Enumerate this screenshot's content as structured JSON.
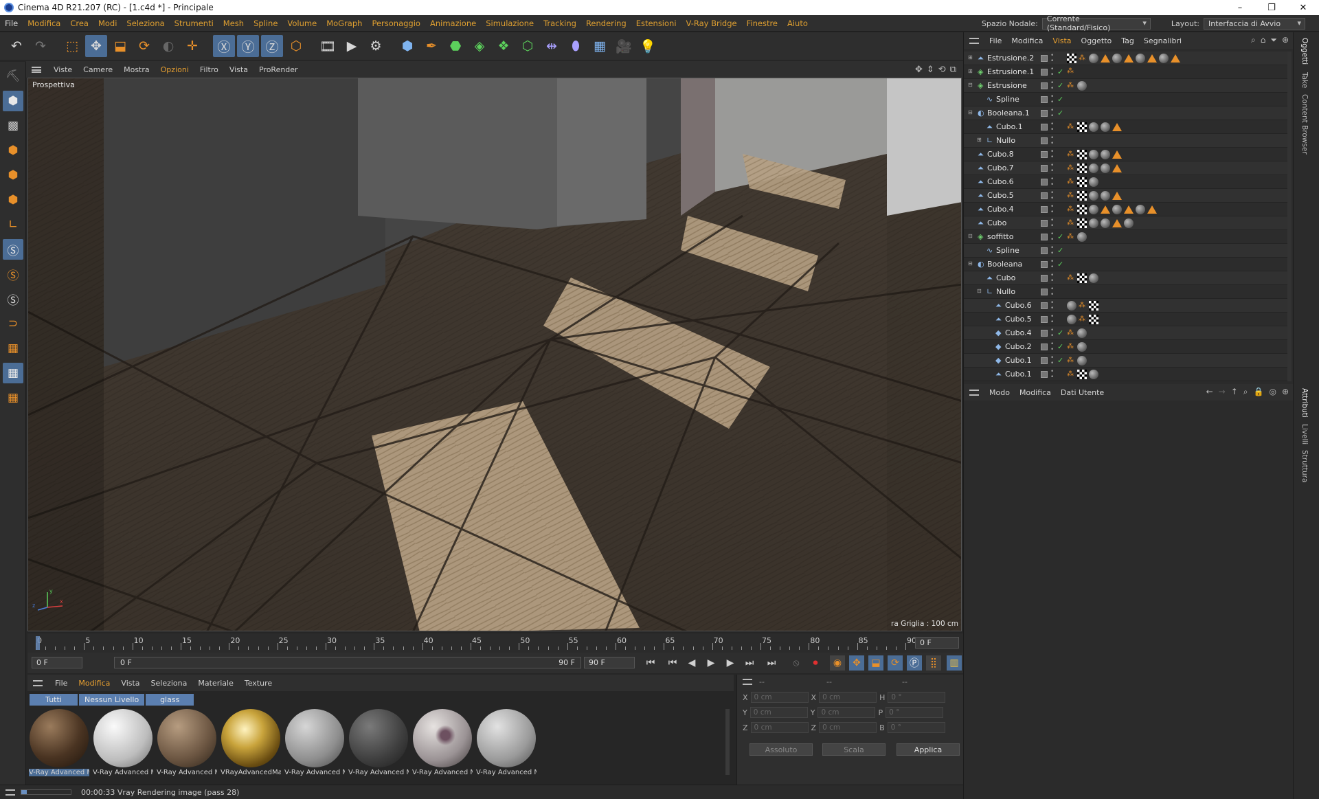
{
  "window": {
    "title": "Cinema 4D R21.207 (RC) - [1.c4d *] - Principale",
    "minimize": "–",
    "restore": "❐",
    "close": "✕"
  },
  "menubar": {
    "items": [
      "File",
      "Modifica",
      "Crea",
      "Modi",
      "Seleziona",
      "Strumenti",
      "Mesh",
      "Spline",
      "Volume",
      "MoGraph",
      "Personaggio",
      "Animazione",
      "Simulazione",
      "Tracking",
      "Rendering",
      "Estensioni",
      "V-Ray Bridge",
      "Finestre",
      "Aiuto"
    ],
    "node_space_label": "Spazio Nodale:",
    "node_space_value": "Corrente (Standard/Fisico)",
    "layout_label": "Layout:",
    "layout_value": "Interfaccia di Avvio"
  },
  "viewport": {
    "menu": [
      "Viste",
      "Camere",
      "Mostra",
      "Opzioni",
      "Filtro",
      "Vista",
      "ProRender"
    ],
    "label": "Prospettiva",
    "grid_label": "ra Griglia : 100 cm",
    "axis_x": "x",
    "axis_y": "y",
    "axis_z": "z"
  },
  "timeline": {
    "ticks": [
      "0",
      "5",
      "10",
      "15",
      "20",
      "25",
      "30",
      "35",
      "40",
      "45",
      "50",
      "55",
      "60",
      "65",
      "70",
      "75",
      "80",
      "85",
      "90"
    ],
    "current_frame": "0 F",
    "start_frame": "0 F",
    "range_start": "0 F",
    "range_end": "90 F",
    "end_frame": "90 F"
  },
  "materials": {
    "menu": [
      "File",
      "Modifica",
      "Vista",
      "Seleziona",
      "Materiale",
      "Texture"
    ],
    "filters": [
      "Tutti",
      "Nessun Livello",
      "glass"
    ],
    "items": [
      {
        "name": "V-Ray Advanced M",
        "style": "wood-dark"
      },
      {
        "name": "V-Ray Advanced M",
        "style": "white-speckle"
      },
      {
        "name": "V-Ray Advanced M",
        "style": "wood-light"
      },
      {
        "name": "VRayAdvancedMa",
        "style": "gold"
      },
      {
        "name": "V-Ray Advanced M",
        "style": "grey-light"
      },
      {
        "name": "V-Ray Advanced M",
        "style": "grey-dark"
      },
      {
        "name": "V-Ray Advanced M",
        "style": "marble"
      },
      {
        "name": "V-Ray Advanced M",
        "style": "grey-soft"
      }
    ]
  },
  "coords": {
    "header_a": "--",
    "header_b": "--",
    "header_c": "--",
    "rows": [
      {
        "a": "X",
        "av": "0 cm",
        "b": "X",
        "bv": "0 cm",
        "c": "H",
        "cv": "0 °"
      },
      {
        "a": "Y",
        "av": "0 cm",
        "b": "Y",
        "bv": "0 cm",
        "c": "P",
        "cv": "0 °"
      },
      {
        "a": "Z",
        "av": "0 cm",
        "b": "Z",
        "bv": "0 cm",
        "c": "B",
        "cv": "0 °"
      }
    ],
    "mode": "Assoluto",
    "scale": "Scala",
    "apply": "Applica"
  },
  "status": {
    "text": "00:00:33 Vray Rendering image (pass 28)"
  },
  "objects": {
    "menu": [
      "File",
      "Modifica",
      "Vista",
      "Oggetto",
      "Tag",
      "Segnalibri"
    ],
    "rows": [
      {
        "name": "Estrusione.2",
        "depth": 0,
        "kind": "poly",
        "exp": "+",
        "tags": "chk,ph,ball,tri,ball,tri,ball,tri,ball,tri"
      },
      {
        "name": "Estrusione.1",
        "depth": 0,
        "kind": "gen",
        "exp": "+",
        "tags": "ph"
      },
      {
        "name": "Estrusione",
        "depth": 0,
        "kind": "gen",
        "exp": "−",
        "tags": "ph,ball"
      },
      {
        "name": "Spline",
        "depth": 1,
        "kind": "spline",
        "exp": "",
        "tags": ""
      },
      {
        "name": "Booleana.1",
        "depth": 0,
        "kind": "bool",
        "exp": "−",
        "tags": ""
      },
      {
        "name": "Cubo.1",
        "depth": 1,
        "kind": "poly",
        "exp": "",
        "tags": "ph,chk,ball,ball,tri"
      },
      {
        "name": "Nullo",
        "depth": 1,
        "kind": "null",
        "exp": "+",
        "tags": ""
      },
      {
        "name": "Cubo.8",
        "depth": 0,
        "kind": "poly",
        "exp": "",
        "tags": "ph,chk,ball,ball,tri"
      },
      {
        "name": "Cubo.7",
        "depth": 0,
        "kind": "poly",
        "exp": "",
        "tags": "ph,chk,ball,ball,tri"
      },
      {
        "name": "Cubo.6",
        "depth": 0,
        "kind": "poly",
        "exp": "",
        "tags": "ph,chk,ball"
      },
      {
        "name": "Cubo.5",
        "depth": 0,
        "kind": "poly",
        "exp": "",
        "tags": "ph,chk,ball,ball,tri"
      },
      {
        "name": "Cubo.4",
        "depth": 0,
        "kind": "poly",
        "exp": "",
        "tags": "ph,chk,ball,tri,ball,tri,ball,tri"
      },
      {
        "name": "Cubo",
        "depth": 0,
        "kind": "poly",
        "exp": "",
        "tags": "ph,chk,ball,ball,tri,ball"
      },
      {
        "name": "soffitto",
        "depth": 0,
        "kind": "gen",
        "exp": "−",
        "tags": "ph,ball"
      },
      {
        "name": "Spline",
        "depth": 1,
        "kind": "spline",
        "exp": "",
        "tags": ""
      },
      {
        "name": "Booleana",
        "depth": 0,
        "kind": "bool",
        "exp": "−",
        "tags": ""
      },
      {
        "name": "Cubo",
        "depth": 1,
        "kind": "poly",
        "exp": "",
        "tags": "ph,chk,ball"
      },
      {
        "name": "Nullo",
        "depth": 1,
        "kind": "null",
        "exp": "−",
        "tags": ""
      },
      {
        "name": "Cubo.6",
        "depth": 2,
        "kind": "poly",
        "exp": "",
        "tags": "ball,ph,chk"
      },
      {
        "name": "Cubo.5",
        "depth": 2,
        "kind": "poly",
        "exp": "",
        "tags": "ball,ph,chk"
      },
      {
        "name": "Cubo.4",
        "depth": 2,
        "kind": "cube",
        "exp": "",
        "tags": "ph,ball"
      },
      {
        "name": "Cubo.2",
        "depth": 2,
        "kind": "cube",
        "exp": "",
        "tags": "ph,ball"
      },
      {
        "name": "Cubo.1",
        "depth": 2,
        "kind": "cube",
        "exp": "",
        "tags": "ph,ball"
      },
      {
        "name": "Cubo.1",
        "depth": 2,
        "kind": "poly",
        "exp": "",
        "tags": "ph,chk,ball"
      }
    ]
  },
  "attributes": {
    "menu": [
      "Modo",
      "Modifica",
      "Dati Utente"
    ]
  },
  "right_tabs": {
    "top": [
      "Oggetti",
      "Take",
      "Content Browser"
    ],
    "bottom": [
      "Attributi",
      "Livelli",
      "Struttura"
    ]
  }
}
